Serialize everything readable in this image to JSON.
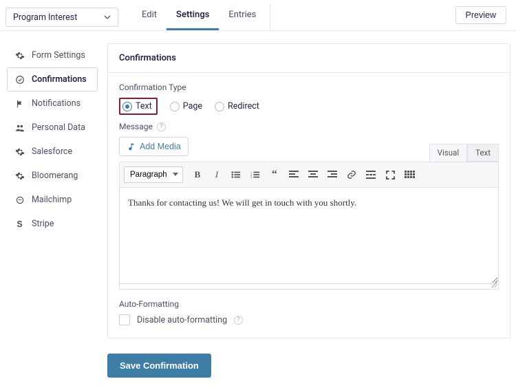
{
  "header": {
    "form_name": "Program Interest",
    "tabs": {
      "edit": "Edit",
      "settings": "Settings",
      "entries": "Entries"
    },
    "preview": "Preview"
  },
  "sidebar": {
    "items": [
      {
        "label": "Form Settings"
      },
      {
        "label": "Confirmations"
      },
      {
        "label": "Notifications"
      },
      {
        "label": "Personal Data"
      },
      {
        "label": "Salesforce"
      },
      {
        "label": "Bloomerang"
      },
      {
        "label": "Mailchimp"
      },
      {
        "label": "Stripe"
      }
    ]
  },
  "panel": {
    "title": "Confirmations",
    "confirmation_type_label": "Confirmation Type",
    "radios": {
      "text": "Text",
      "page": "Page",
      "redirect": "Redirect"
    },
    "message_label": "Message",
    "add_media": "Add Media",
    "editor_tabs": {
      "visual": "Visual",
      "text": "Text"
    },
    "paragraph_option": "Paragraph",
    "editor_content": "Thanks for contacting us! We will get in touch with you shortly.",
    "auto_formatting_label": "Auto-Formatting",
    "disable_auto_label": "Disable auto-formatting",
    "save_button": "Save Confirmation"
  }
}
